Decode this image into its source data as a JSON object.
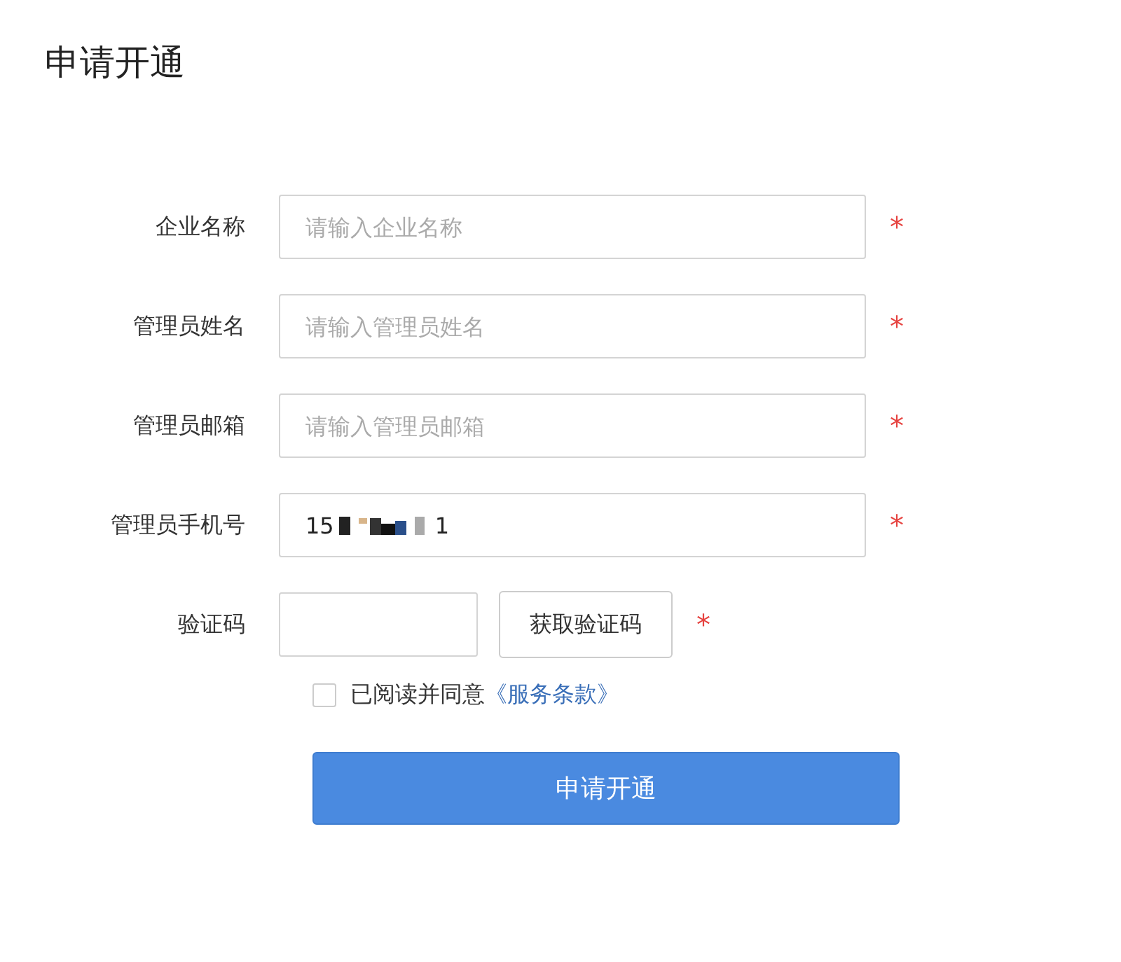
{
  "title": "申请开通",
  "fields": [
    {
      "kind": "text",
      "label": "企业名称",
      "placeholder": "请输入企业名称",
      "required_mark": "*"
    },
    {
      "kind": "text",
      "label": "管理员姓名",
      "placeholder": "请输入管理员姓名",
      "required_mark": "*"
    },
    {
      "kind": "text",
      "label": "管理员邮箱",
      "placeholder": "请输入管理员邮箱",
      "required_mark": "*"
    },
    {
      "kind": "redacted",
      "label": "管理员手机号",
      "value_start": "15",
      "value_end": "1",
      "required_mark": "*"
    },
    {
      "kind": "code",
      "label": "验证码",
      "button": "获取验证码",
      "required_mark": "*"
    }
  ],
  "agreement": {
    "checked": false,
    "text": "已阅读并同意",
    "link": "《服务条款》"
  },
  "submit": "申请开通"
}
